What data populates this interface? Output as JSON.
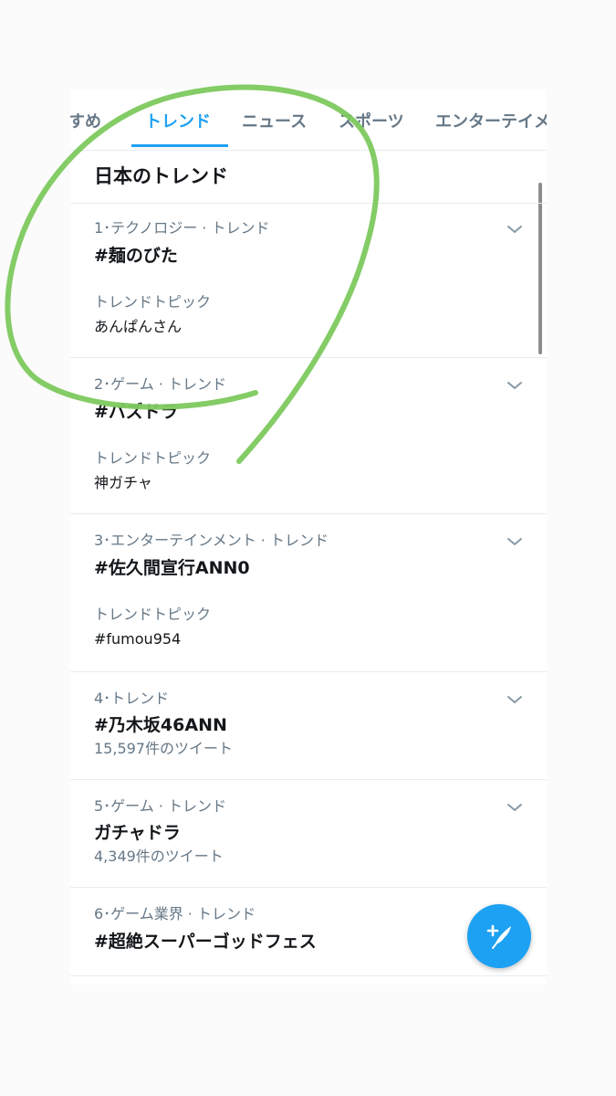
{
  "tabs": [
    {
      "label": "すすめ"
    },
    {
      "label": "トレンド"
    },
    {
      "label": "ニュース"
    },
    {
      "label": "スポーツ"
    },
    {
      "label": "エンターテイメント"
    }
  ],
  "active_tab": "トレンド",
  "section_title": "日本のトレンド",
  "trends": [
    {
      "meta": "1･テクノロジー · トレンド",
      "name": "#麺のびた",
      "topic_label": "トレンドトピック",
      "topic": "あんぱんさん"
    },
    {
      "meta": "2･ゲーム · トレンド",
      "name": "#パズドラ",
      "topic_label": "トレンドトピック",
      "topic": "神ガチャ"
    },
    {
      "meta": "3･エンターテインメント · トレンド",
      "name": "#佐久間宣行ANN0",
      "topic_label": "トレンドトピック",
      "topic": "#fumou954"
    },
    {
      "meta": "4･トレンド",
      "name": "#乃木坂46ANN",
      "count": "15,597件のツイート"
    },
    {
      "meta": "5･ゲーム · トレンド",
      "name": "ガチャドラ",
      "count": "4,349件のツイート"
    },
    {
      "meta": "6･ゲーム業界 · トレンド",
      "name": "#超絶スーパーゴッドフェス"
    }
  ],
  "icons": {
    "more": "chevron-down-icon",
    "compose": "compose-tweet-icon"
  },
  "colors": {
    "accent": "#1da1f2",
    "secondary_text": "#657786",
    "annotation": "#7dc95e"
  }
}
